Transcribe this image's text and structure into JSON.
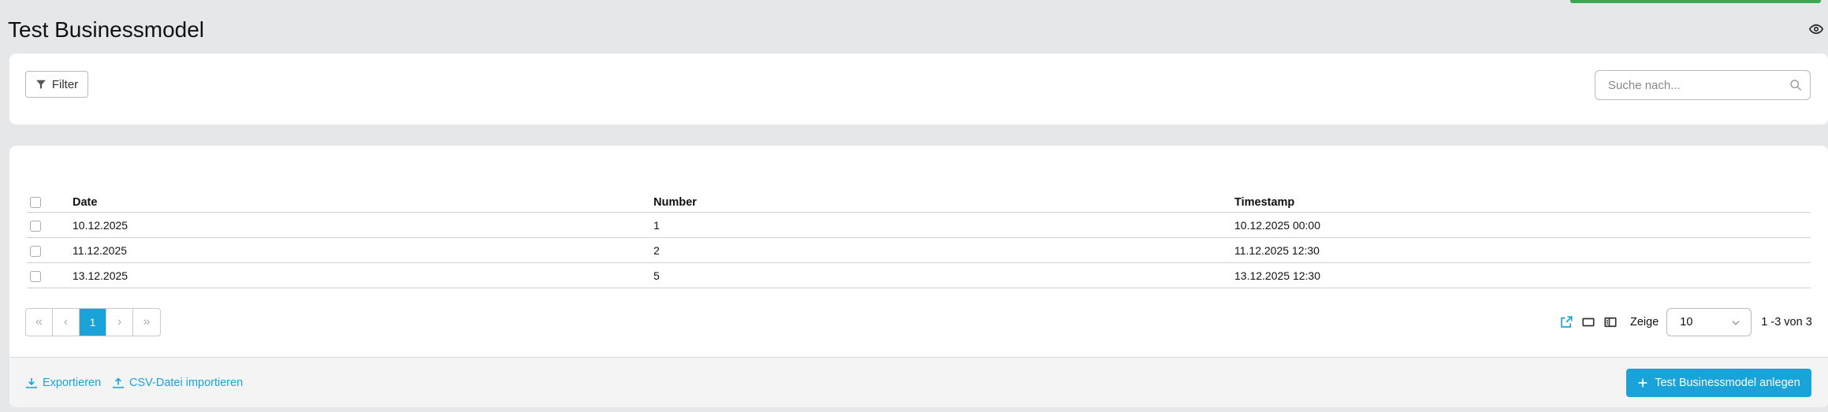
{
  "page": {
    "title": "Test Businessmodel"
  },
  "filter": {
    "label": "Filter"
  },
  "search": {
    "placeholder": "Suche nach..."
  },
  "table": {
    "headers": [
      "Date",
      "Number",
      "Timestamp"
    ],
    "rows": [
      [
        "10.12.2025",
        "1",
        "10.12.2025 00:00"
      ],
      [
        "11.12.2025",
        "2",
        "11.12.2025 12:30"
      ],
      [
        "13.12.2025",
        "5",
        "13.12.2025 12:30"
      ]
    ]
  },
  "pagination": {
    "first": "«",
    "prev": "‹",
    "current": "1",
    "next": "›",
    "last": "»"
  },
  "page_size": {
    "label": "Zeige",
    "value": "10",
    "range": "1 -3 von 3"
  },
  "footer": {
    "export_label": "Exportieren",
    "import_label": "CSV-Datei importieren",
    "create_label": "Test Businessmodel anlegen"
  },
  "colors": {
    "accent": "#1aa3d9",
    "success": "#3aa853",
    "background": "#e6e7e8"
  },
  "icons": [
    "eye-icon",
    "filter-icon",
    "search-icon",
    "external-link-icon",
    "single-column-icon",
    "split-column-icon",
    "chevron-down-icon",
    "download-icon",
    "upload-icon",
    "plus-icon"
  ]
}
